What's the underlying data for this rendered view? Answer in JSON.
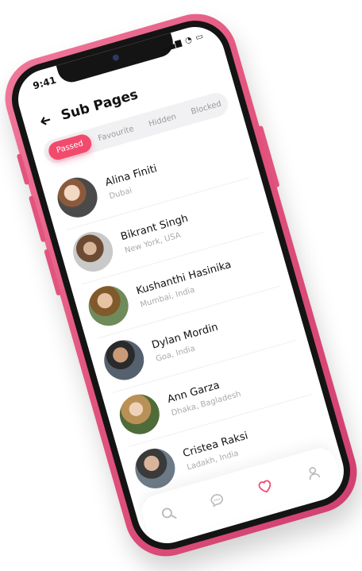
{
  "status_bar": {
    "time": "9:41",
    "icons": "▂▄▆ ◔ ▭"
  },
  "header": {
    "title": "Sub Pages"
  },
  "tabs": [
    {
      "label": "Passed",
      "active": true
    },
    {
      "label": "Favourite",
      "active": false
    },
    {
      "label": "Hidden",
      "active": false
    },
    {
      "label": "Blocked",
      "active": false
    }
  ],
  "people": [
    {
      "name": "Alina Finiti",
      "location": "Dubai"
    },
    {
      "name": "Bikrant Singh",
      "location": "New York, USA"
    },
    {
      "name": "Kushanthi Hasinika",
      "location": "Mumbai, India"
    },
    {
      "name": "Dylan Mordin",
      "location": "Goa, India"
    },
    {
      "name": "Ann Garza",
      "location": "Dhaka, Bagladesh"
    },
    {
      "name": "Cristea Raksi",
      "location": "Ladakh, India"
    }
  ],
  "bottom_nav": [
    {
      "icon": "search-icon"
    },
    {
      "icon": "chat-icon"
    },
    {
      "icon": "heart-icon",
      "active": true
    },
    {
      "icon": "profile-icon"
    }
  ],
  "colors": {
    "accent": "#f24a6d",
    "frame": "#e2547d"
  }
}
